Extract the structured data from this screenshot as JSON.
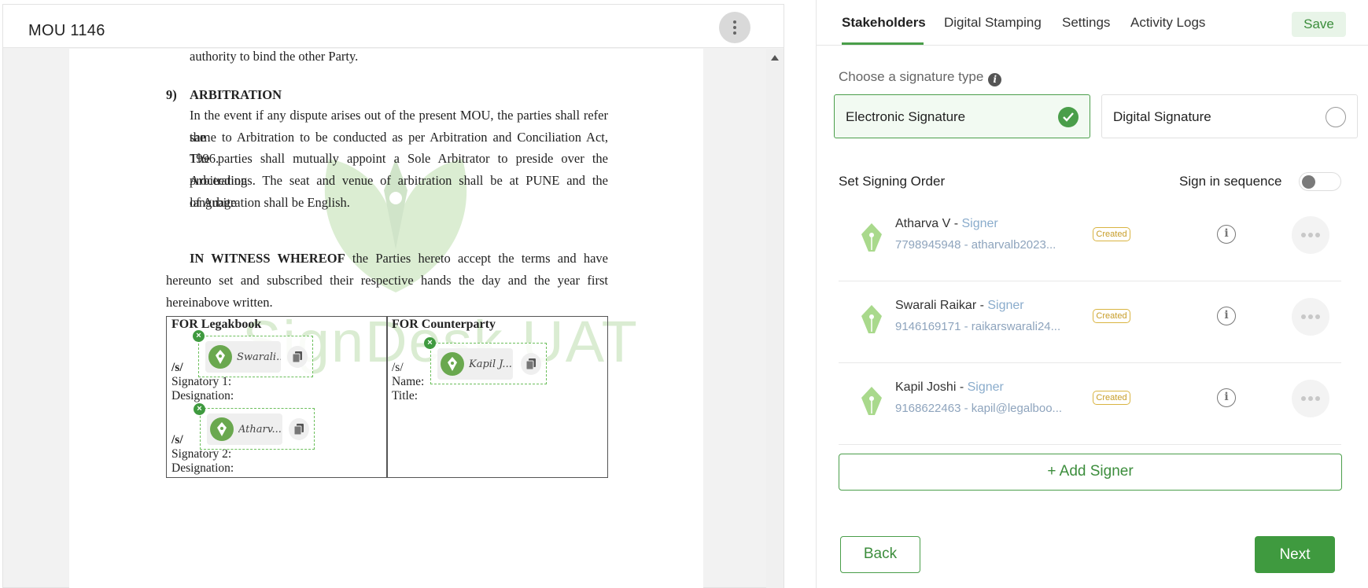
{
  "document": {
    "title": "MOU 1146",
    "authority_line": "authority to bind the other Party.",
    "clause_number": "9)",
    "clause_title": "ARBITRATION",
    "clause_lines": [
      "In the event if any dispute arises out of the present MOU, the parties shall refer the",
      "same to Arbitration to be conducted as per Arbitration and Conciliation Act, 1996.",
      "The parties shall mutually appoint a Sole Arbitrator to preside over the Arbitration",
      "proceedings. The seat and venue of arbitration shall be at PUNE and the language",
      "of Arbitration shall be English."
    ],
    "witness_bold": "IN WITNESS WHEREOF",
    "witness_rest": " the Parties hereto accept the terms and have hereunto set and subscribed their respective hands the day and the year first hereinabove written.",
    "watermark": "SignDesk UAT",
    "table": {
      "left_header": "FOR Legakbook",
      "right_header": "FOR Counterparty",
      "s1": "/s/",
      "signatory1": "Signatory 1:",
      "designation1": "Designation:",
      "s2": "/s/",
      "signatory2": "Signatory 2:",
      "designation2": "Designation:",
      "s3": "/s/",
      "name": "Name:",
      "title": "Title:"
    },
    "placed_signatures": [
      {
        "name": "Swarali...",
        "remove": "×"
      },
      {
        "name": "Atharv...",
        "remove": "×"
      },
      {
        "name": "Kapil J...",
        "remove": "×"
      }
    ]
  },
  "tabs": [
    {
      "label": "Stakeholders",
      "active": true
    },
    {
      "label": "Digital Stamping",
      "active": false
    },
    {
      "label": "Settings",
      "active": false
    },
    {
      "label": "Activity Logs",
      "active": false
    }
  ],
  "save_label": "Save",
  "signature_type": {
    "label": "Choose a signature type",
    "info": "i",
    "options": [
      {
        "label": "Electronic Signature",
        "selected": true
      },
      {
        "label": "Digital Signature",
        "selected": false
      }
    ]
  },
  "signing_order": {
    "label": "Set Signing Order",
    "sequence_label": "Sign in sequence",
    "sequence_on": false
  },
  "signers": [
    {
      "name": "Atharva V",
      "sep": " - ",
      "role": "Signer",
      "contact": "7798945948 - atharvalb2023...",
      "status": "Created",
      "info": "i"
    },
    {
      "name": "Swarali Raikar",
      "sep": " - ",
      "role": "Signer",
      "contact": "9146169171 - raikarswarali24...",
      "status": "Created",
      "info": "i"
    },
    {
      "name": "Kapil Joshi",
      "sep": " - ",
      "role": "Signer",
      "contact": "9168622463 - kapil@legalboo...",
      "status": "Created",
      "info": "i"
    }
  ],
  "add_signer_label": "+ Add Signer",
  "back_label": "Back",
  "next_label": "Next",
  "colors": {
    "accent": "#3f9a3f",
    "badge": "#d9b441",
    "role": "#8aaccc"
  }
}
